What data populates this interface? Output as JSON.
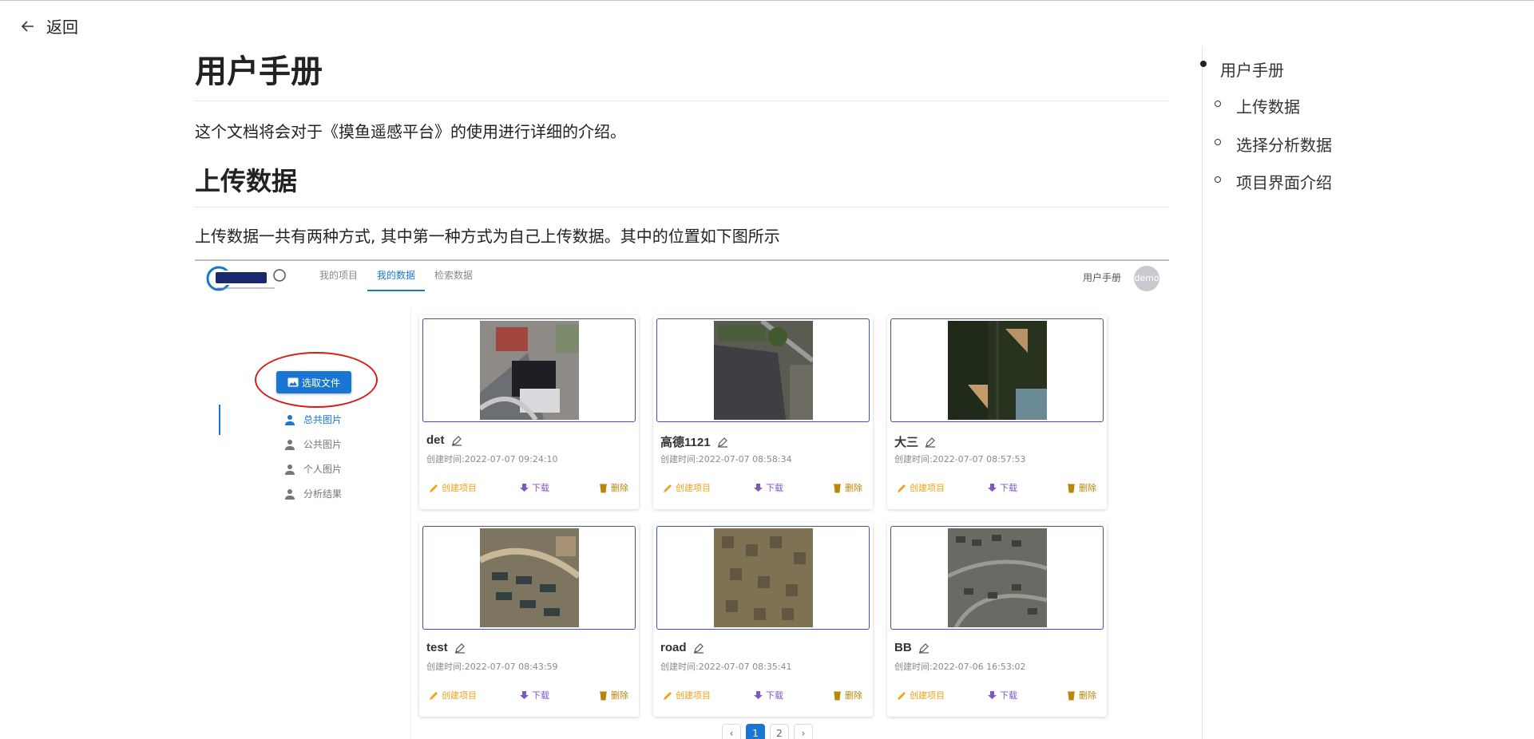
{
  "back": {
    "label": "返回"
  },
  "doc": {
    "title": "用户手册",
    "intro": "这个文档将会对于《摸鱼遥感平台》的使用进行详细的介绍。",
    "section_title": "上传数据",
    "section_text": "上传数据一共有两种方式, 其中第一种方式为自己上传数据。其中的位置如下图所示"
  },
  "screenshot": {
    "nav": [
      "我的项目",
      "我的数据",
      "检索数据"
    ],
    "nav_active": "我的数据",
    "help_label": "用户手册",
    "avatar_label": "demo",
    "pick_file_label": "选取文件",
    "side_items": [
      "总共图片",
      "公共图片",
      "个人图片",
      "分析结果"
    ],
    "cards": [
      {
        "name": "det",
        "time": "创建时间:2022-07-07 09:24:10"
      },
      {
        "name": "高德1121",
        "time": "创建时间:2022-07-07 08:58:34"
      },
      {
        "name": "大三",
        "time": "创建时间:2022-07-07 08:57:53"
      },
      {
        "name": "test",
        "time": "创建时间:2022-07-07 08:43:59"
      },
      {
        "name": "road",
        "time": "创建时间:2022-07-07 08:35:41"
      },
      {
        "name": "BB",
        "time": "创建时间:2022-07-06 16:53:02"
      }
    ],
    "actions": {
      "create": "创建项目",
      "download": "下载",
      "delete": "删除"
    },
    "pages": [
      "1",
      "2"
    ],
    "current_page": "1",
    "colors": {
      "primary": "#1976d2",
      "highlight_ring": "#d81b1b",
      "create": "#f0a31a",
      "download": "#7e57c2"
    }
  },
  "toc": {
    "items": [
      "用户手册",
      "上传数据",
      "选择分析数据",
      "项目界面介绍"
    ]
  }
}
